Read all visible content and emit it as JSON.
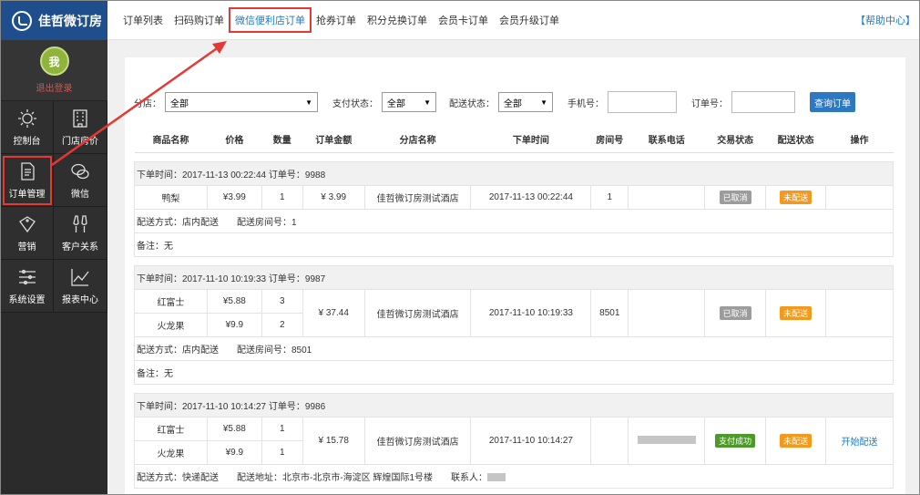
{
  "app": {
    "title": "佳哲微订房"
  },
  "user": {
    "avatar_text": "我",
    "logout": "退出登录"
  },
  "sidebar": {
    "items": [
      {
        "label": "控制台",
        "icon": "sun-icon"
      },
      {
        "label": "门店房价",
        "icon": "building-icon"
      },
      {
        "label": "订单管理",
        "icon": "document-icon"
      },
      {
        "label": "微信",
        "icon": "wechat-icon"
      },
      {
        "label": "营销",
        "icon": "sale-tag-icon"
      },
      {
        "label": "客户关系",
        "icon": "glasses-toast-icon"
      },
      {
        "label": "系统设置",
        "icon": "sliders-icon"
      },
      {
        "label": "报表中心",
        "icon": "line-chart-icon"
      }
    ]
  },
  "tabs": [
    "订单列表",
    "扫码购订单",
    "微信便利店订单",
    "抢券订单",
    "积分兑换订单",
    "会员卡订单",
    "会员升级订单"
  ],
  "help": "【帮助中心】",
  "filters": {
    "store_label": "分店：",
    "store_value": "全部",
    "pay_label": "支付状态：",
    "pay_value": "全部",
    "ship_label": "配送状态：",
    "ship_value": "全部",
    "phone_label": "手机号：",
    "order_label": "订单号：",
    "query_btn": "查询订单"
  },
  "table": {
    "headers": [
      "商品名称",
      "价格",
      "数量",
      "订单金额",
      "分店名称",
      "下单时间",
      "房间号",
      "联系电话",
      "交易状态",
      "配送状态",
      "操作"
    ],
    "orders": [
      {
        "header": "下单时间：2017-11-13 00:22:44 订单号：9988",
        "items": [
          {
            "name": "鸭梨",
            "price": "¥3.99",
            "qty": "1"
          }
        ],
        "amount": "¥ 3.99",
        "store": "佳哲微订房测试酒店",
        "time": "2017-11-13 00:22:44",
        "room": "1",
        "trade_status": "已取消",
        "ship_status": "未配送",
        "action": "",
        "ship_info": "配送方式：店内配送　　配送房间号：1",
        "remark": "备注：无"
      },
      {
        "header": "下单时间：2017-11-10 10:19:33 订单号：9987",
        "items": [
          {
            "name": "红富士",
            "price": "¥5.88",
            "qty": "3"
          },
          {
            "name": "火龙果",
            "price": "¥9.9",
            "qty": "2"
          }
        ],
        "amount": "¥ 37.44",
        "store": "佳哲微订房测试酒店",
        "time": "2017-11-10 10:19:33",
        "room": "8501",
        "trade_status": "已取消",
        "ship_status": "未配送",
        "action": "",
        "ship_info": "配送方式：店内配送　　配送房间号：8501",
        "remark": "备注：无"
      },
      {
        "header": "下单时间：2017-11-10 10:14:27 订单号：9986",
        "items": [
          {
            "name": "红富士",
            "price": "¥5.88",
            "qty": "1"
          },
          {
            "name": "火龙果",
            "price": "¥9.9",
            "qty": "1"
          }
        ],
        "amount": "¥ 15.78",
        "store": "佳哲微订房测试酒店",
        "time": "2017-11-10 10:14:27",
        "room": "",
        "trade_status": "支付成功",
        "ship_status": "未配送",
        "action": "开始配送",
        "ship_info": "配送方式：快递配送　　配送地址：北京市-北京市-海淀区 辉煌国际1号楼　　联系人：",
        "remark": ""
      }
    ]
  },
  "colors": {
    "accent": "#1a7bc9",
    "annotation": "#e53935",
    "brand": "#1f4e8c"
  }
}
